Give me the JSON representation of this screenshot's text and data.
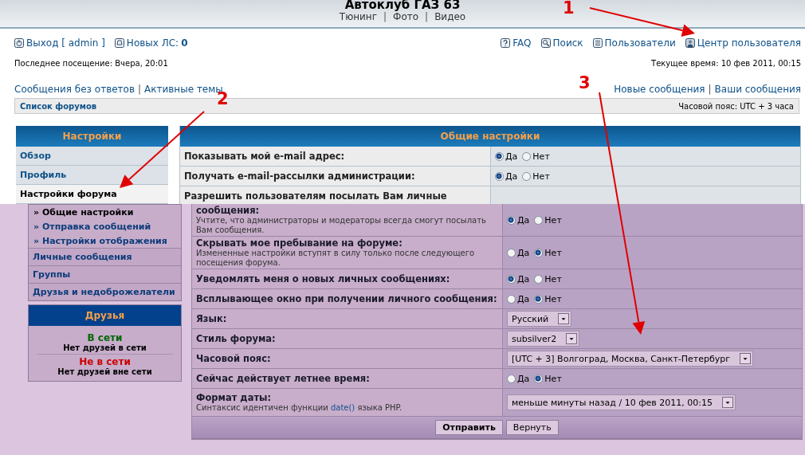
{
  "header": {
    "title": "Автоклуб ГАЗ 63",
    "links": [
      {
        "kind": "link",
        "text": "Тюнинг"
      },
      {
        "kind": "separator",
        "text": "|"
      },
      {
        "kind": "link",
        "text": "Фото"
      },
      {
        "kind": "separator",
        "text": "|"
      },
      {
        "kind": "link",
        "text": "Видео"
      }
    ]
  },
  "nav": {
    "left": [
      {
        "kind": "logout",
        "label": "Выход [ admin ]"
      },
      {
        "kind": "messages",
        "label": "Новых ЛС:",
        "count": "0"
      }
    ],
    "right": [
      {
        "kind": "faq",
        "label": "FAQ"
      },
      {
        "kind": "search",
        "label": "Поиск"
      },
      {
        "kind": "members",
        "label": "Пользователи"
      },
      {
        "kind": "user",
        "label": "Центр пользователя"
      }
    ]
  },
  "last_visit": "Последнее посещение: Вчера, 20:01",
  "current_time": "Текущее время: 10 фев 2011, 00:15",
  "links_left": [
    {
      "kind": "link",
      "text": "Сообщения без ответов"
    },
    {
      "kind": "separator",
      "text": "|"
    },
    {
      "kind": "link",
      "text": "Активные темы"
    }
  ],
  "links_right": [
    {
      "kind": "link",
      "text": "Новые сообщения"
    },
    {
      "kind": "separator",
      "text": "|"
    },
    {
      "kind": "link",
      "text": "Ваши сообщения"
    }
  ],
  "breadcrumb": {
    "label": "Список форумов",
    "timezone": "Часовой пояс: UTC + 3 часа"
  },
  "top_screen": {
    "sidebar": {
      "title": "Настройки",
      "items": [
        {
          "label": "Обзор",
          "selected": false
        },
        {
          "label": "Профиль",
          "selected": false
        },
        {
          "label": "Настройки форума",
          "selected": true
        }
      ]
    },
    "settings": {
      "title": "Общие настройки",
      "rows": [
        {
          "kind": "radio",
          "label": "Показывать мой e-mail адрес:",
          "options": [
            {
              "label": "Да",
              "selected": true
            },
            {
              "label": "Нет",
              "selected": false
            }
          ]
        },
        {
          "kind": "radio",
          "label": "Получать e-mail-рассылки администрации:",
          "options": [
            {
              "label": "Да",
              "selected": true
            },
            {
              "label": "Нет",
              "selected": false
            }
          ]
        },
        {
          "kind": "partial",
          "label": "Разрешить пользователям посылать Вам личные"
        }
      ]
    }
  },
  "overlay_screen": {
    "sidebar": {
      "items": [
        {
          "kind": "sub",
          "label": "» Общие настройки",
          "selected": true
        },
        {
          "kind": "sub",
          "label": "» Отправка сообщений",
          "selected": false
        },
        {
          "kind": "sub",
          "label": "» Настройки отображения",
          "selected": false
        },
        {
          "kind": "main",
          "label": "Личные сообщения",
          "selected": false
        },
        {
          "kind": "main",
          "label": "Группы",
          "selected": false
        },
        {
          "kind": "main",
          "label": "Друзья и недоброжелатели",
          "selected": false
        }
      ]
    },
    "friends": {
      "title": "Друзья",
      "groups": [
        {
          "status": "В сети",
          "color": "#006600",
          "note": "Нет друзей в сети"
        },
        {
          "status": "Не в сети",
          "color": "#cc0000",
          "note": "Нет друзей вне сети"
        }
      ]
    },
    "settings": {
      "rows": [
        {
          "kind": "radio",
          "label": "сообщения:",
          "description": [
            {
              "text": "Учтите, что администраторы и модераторы всегда смогут посылать Вам сообщения."
            }
          ],
          "options": [
            {
              "label": "Да",
              "selected": true
            },
            {
              "label": "Нет",
              "selected": false
            }
          ]
        },
        {
          "kind": "radio",
          "label": "Скрывать мое пребывание на форуме:",
          "description": [
            {
              "text": "Измененные настройки вступят в силу только после следующего посещения форума."
            }
          ],
          "options": [
            {
              "label": "Да",
              "selected": false
            },
            {
              "label": "Нет",
              "selected": true
            }
          ]
        },
        {
          "kind": "radio",
          "label": "Уведомлять меня о новых личных сообщениях:",
          "options": [
            {
              "label": "Да",
              "selected": true
            },
            {
              "label": "Нет",
              "selected": false
            }
          ]
        },
        {
          "kind": "radio",
          "label": "Всплывающее окно при получении личного сообщения:",
          "options": [
            {
              "label": "Да",
              "selected": false
            },
            {
              "label": "Нет",
              "selected": true
            }
          ]
        },
        {
          "kind": "select",
          "label": "Язык:",
          "value": "Русский"
        },
        {
          "kind": "select",
          "label": "Стиль форума:",
          "value": "subsilver2"
        },
        {
          "kind": "select",
          "label": "Часовой пояс:",
          "value": "[UTC + 3] Волгоград, Москва, Санкт-Петербург"
        },
        {
          "kind": "radio",
          "label": "Сейчас действует летнее время:",
          "options": [
            {
              "label": "Да",
              "selected": false
            },
            {
              "label": "Нет",
              "selected": true
            }
          ]
        },
        {
          "kind": "select",
          "label": "Формат даты:",
          "description": [
            {
              "text": "Синтаксис идентичен функции "
            },
            {
              "kind": "link",
              "text": "date()"
            },
            {
              "text": " языка PHP."
            }
          ],
          "value": "меньше минуты назад / 10 фев 2011, 00:15"
        }
      ],
      "buttons": [
        {
          "kind": "primary",
          "label": "Отправить"
        },
        {
          "kind": "secondary",
          "label": "Вернуть"
        }
      ]
    }
  },
  "annotations": [
    {
      "label": "1"
    },
    {
      "label": "2"
    },
    {
      "label": "3"
    }
  ]
}
